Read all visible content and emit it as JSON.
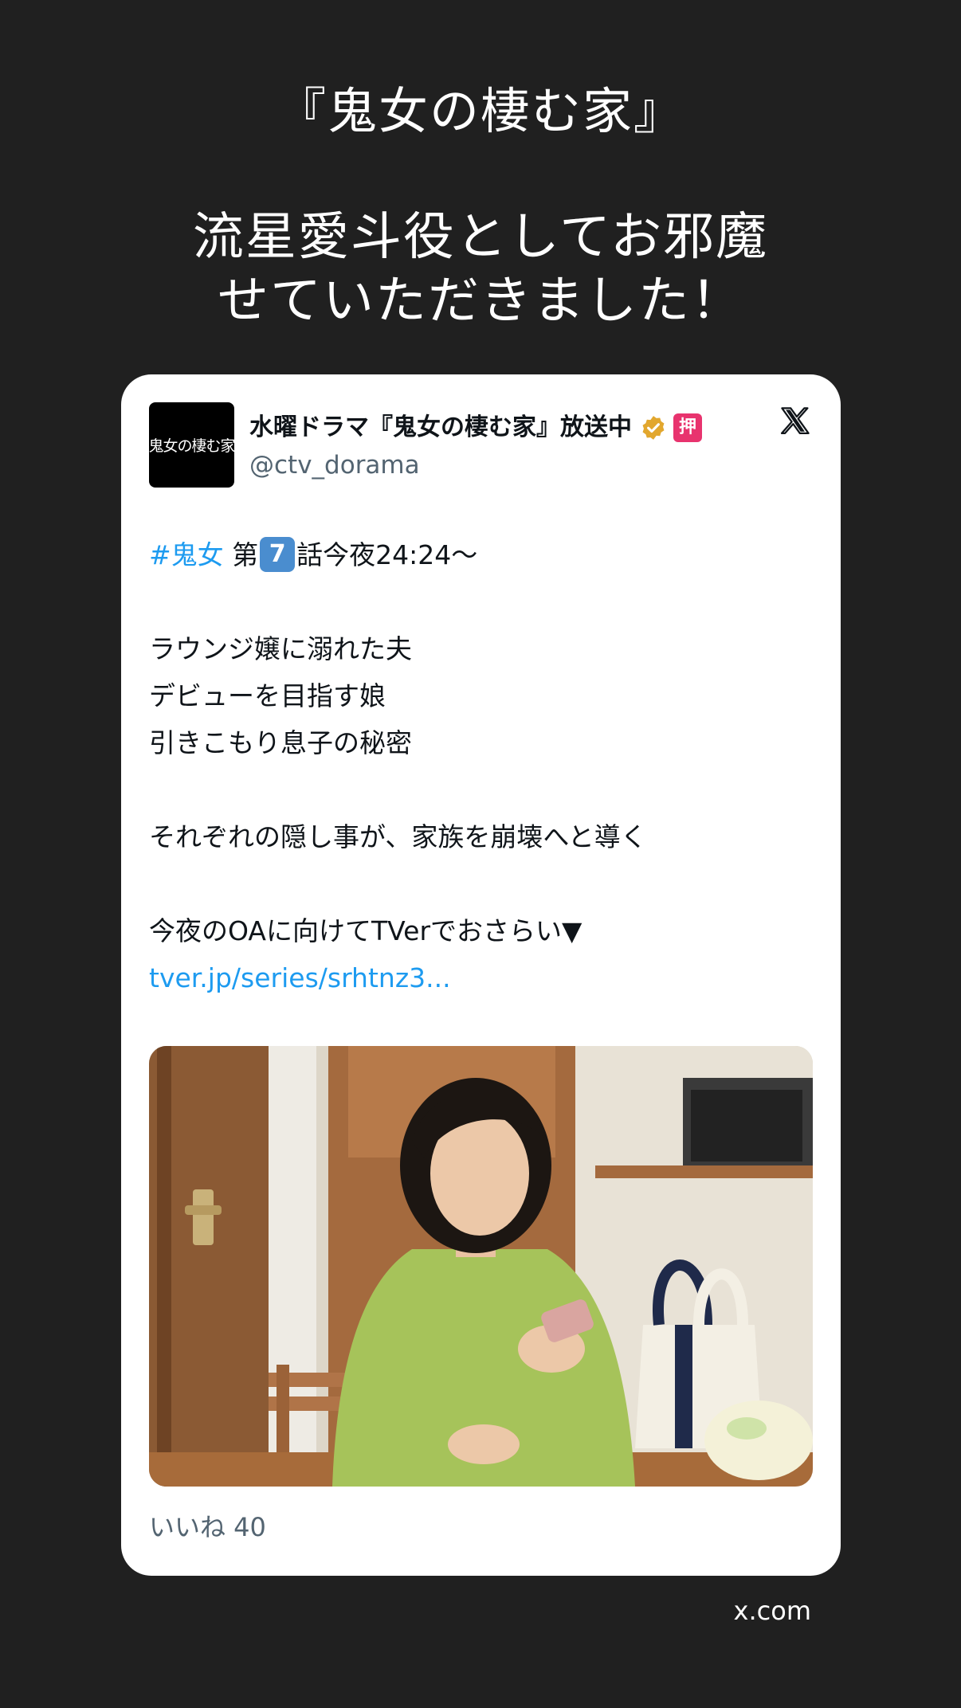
{
  "caption": {
    "title": "『鬼女の棲む家』",
    "line1": "流星愛斗役としてお邪魔",
    "line2": "せていただきました！"
  },
  "tweet": {
    "avatar_text": "鬼女の棲む家",
    "display_name": "水曜ドラマ『鬼女の棲む家』放送中",
    "affiliate_badge": "押",
    "handle": "@ctv_dorama",
    "hashtag": "#鬼女",
    "episode_prefix": "第",
    "episode_keycap": "7",
    "episode_suffix": "話今夜24:24〜",
    "body_line1": "ラウンジ嬢に溺れた夫",
    "body_line2": "デビューを目指す娘",
    "body_line3": "引きこもり息子の秘密",
    "body_line4": "それぞれの隠し事が、家族を崩壊へと導く",
    "body_line5": "今夜のOAに向けてTVerでおさらい▼",
    "link": "tver.jp/series/srhtnz3...",
    "likes": "いいね 40"
  },
  "footer": {
    "source": "x.com"
  },
  "colors": {
    "background": "#202020",
    "card": "#ffffff",
    "link": "#1d9bf0",
    "secondary_text": "#536471",
    "verified_badge": "#e2a72e",
    "affiliate_badge": "#e8336e",
    "keycap": "#4a8dcf"
  },
  "icons": {
    "verified": "verified-check-badge-icon",
    "affiliate": "affiliate-badge-icon",
    "x_logo": "x-logo-icon"
  }
}
